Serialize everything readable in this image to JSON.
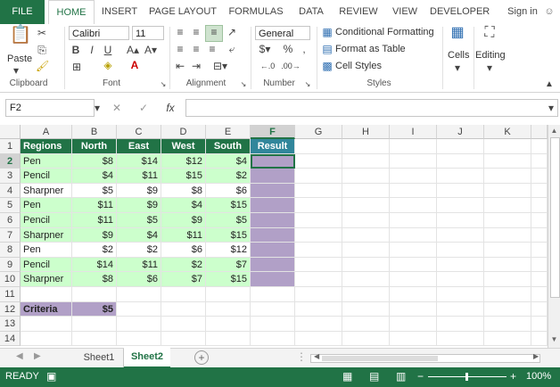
{
  "tabs": [
    "FILE",
    "HOME",
    "INSERT",
    "PAGE LAYOUT",
    "FORMULAS",
    "DATA",
    "REVIEW",
    "VIEW",
    "DEVELOPER"
  ],
  "sign_in": "Sign in",
  "ribbon": {
    "clipboard": {
      "paste": "Paste",
      "label": "Clipboard"
    },
    "font": {
      "name": "Calibri",
      "size": "11",
      "label": "Font"
    },
    "alignment": {
      "label": "Alignment"
    },
    "number": {
      "format": "General",
      "label": "Number"
    },
    "styles": {
      "conditional": "Conditional Formatting",
      "format_table": "Format as Table",
      "cell_styles": "Cell Styles",
      "label": "Styles"
    },
    "cells": {
      "label": "Cells"
    },
    "editing": {
      "label": "Editing"
    }
  },
  "namebox": "F2",
  "fx": "fx",
  "columns": [
    "A",
    "B",
    "C",
    "D",
    "E",
    "F",
    "G",
    "H",
    "I",
    "J",
    "K"
  ],
  "rows": [
    "1",
    "2",
    "3",
    "4",
    "5",
    "6",
    "7",
    "8",
    "9",
    "10",
    "11",
    "12",
    "13",
    "14"
  ],
  "table": {
    "headers": [
      "Regions",
      "North",
      "East",
      "West",
      "South",
      "Result"
    ],
    "data": [
      [
        "Pen",
        "$8",
        "$14",
        "$12",
        "$4"
      ],
      [
        "Pencil",
        "$4",
        "$11",
        "$15",
        "$2"
      ],
      [
        "Sharpner",
        "$5",
        "$9",
        "$8",
        "$6"
      ],
      [
        "Pen",
        "$11",
        "$9",
        "$4",
        "$15"
      ],
      [
        "Pencil",
        "$11",
        "$5",
        "$9",
        "$5"
      ],
      [
        "Sharpner",
        "$9",
        "$4",
        "$11",
        "$15"
      ],
      [
        "Pen",
        "$2",
        "$2",
        "$6",
        "$12"
      ],
      [
        "Pencil",
        "$14",
        "$11",
        "$2",
        "$7"
      ],
      [
        "Sharpner",
        "$8",
        "$6",
        "$7",
        "$15"
      ]
    ]
  },
  "criteria": {
    "label": "Criteria",
    "value": "$5"
  },
  "sheets": [
    "Sheet1",
    "Sheet2"
  ],
  "active_sheet": "Sheet2",
  "status": {
    "ready": "READY",
    "zoom": "100%"
  },
  "colors": {
    "accent": "#217346",
    "highlight_green": "#ccffcc",
    "highlight_purple": "#b1a0c7"
  }
}
